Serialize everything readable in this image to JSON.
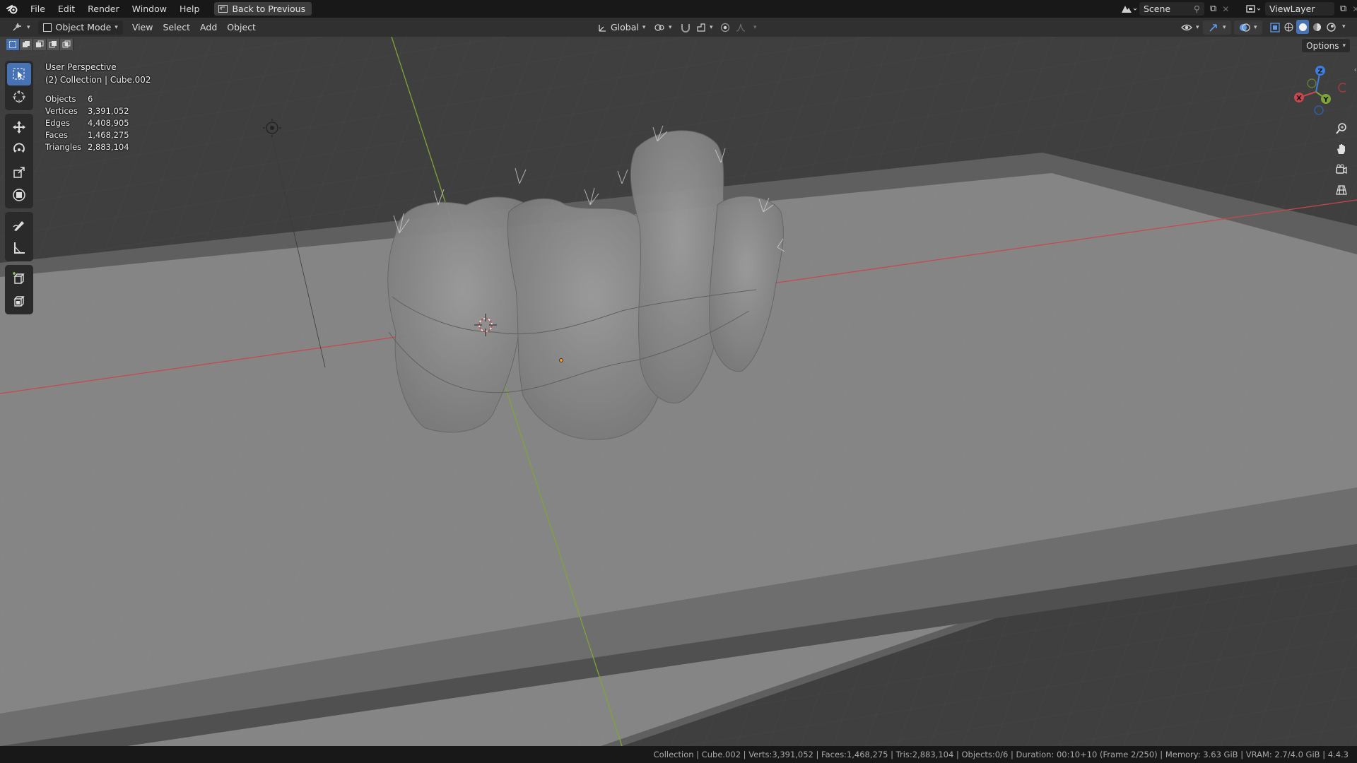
{
  "topbar": {
    "menu": [
      "File",
      "Edit",
      "Render",
      "Window",
      "Help"
    ],
    "back_label": "Back to Previous",
    "scene": "Scene",
    "view_layer": "ViewLayer"
  },
  "header": {
    "mode": "Object Mode",
    "menus": [
      "View",
      "Select",
      "Add",
      "Object"
    ],
    "transform_orientation": "Global"
  },
  "overlay": {
    "view_name": "User Perspective",
    "collection_line": "(2) Collection | Cube.002",
    "stats": [
      {
        "label": "Objects",
        "value": "6"
      },
      {
        "label": "Vertices",
        "value": "3,391,052"
      },
      {
        "label": "Edges",
        "value": "4,408,905"
      },
      {
        "label": "Faces",
        "value": "1,468,275"
      },
      {
        "label": "Triangles",
        "value": "2,883,104"
      }
    ]
  },
  "options_label": "Options",
  "gizmo": {
    "x": "X",
    "y": "Y",
    "z": "Z"
  },
  "statusbar": {
    "text": "Collection | Cube.002 | Verts:3,391,052 | Faces:1,468,275 | Tris:2,883,104 | Objects:0/6 | Duration: 00:10+10 (Frame 2/250) | Memory: 3.63 GiB | VRAM: 2.7/4.0 GiB | 4.4.3"
  },
  "colors": {
    "accent": "#4772b3",
    "x_axis": "#c8474f",
    "y_axis": "#7ea437",
    "z_axis": "#3d7fe0"
  }
}
